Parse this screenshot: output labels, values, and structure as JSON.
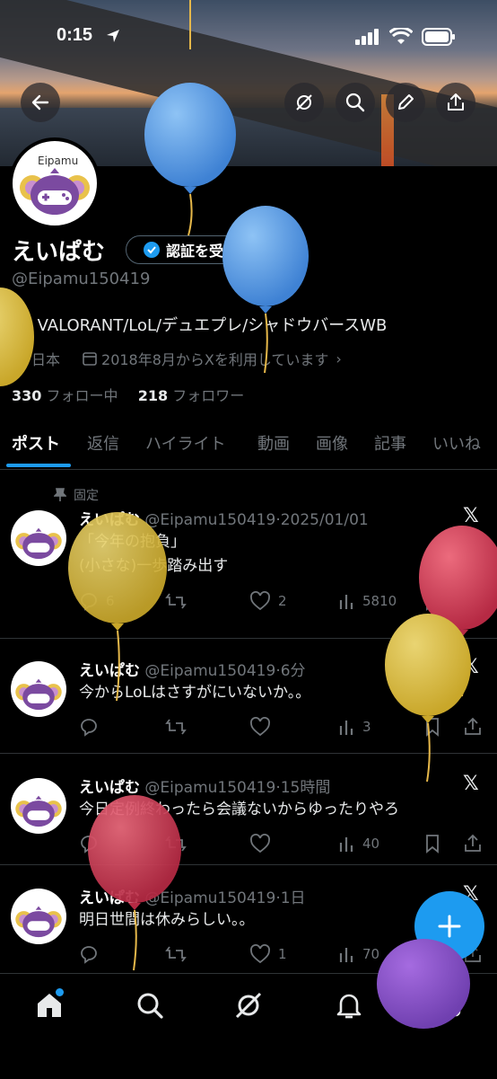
{
  "status_bar": {
    "time": "0:15"
  },
  "profile": {
    "display_name": "えいぱむ",
    "verify_button": "認証を受ける",
    "handle": "@Eipamu150419",
    "bio": "25 VALORANT/LoL/デュエプレ/シャドウバースWB",
    "location": "日本",
    "joined": "2018年8月からXを利用しています",
    "following_count": "330",
    "following_label": "フォロー中",
    "followers_count": "218",
    "followers_label": "フォロワー",
    "avatar_text": "Eipamu"
  },
  "tabs": [
    "ポスト",
    "返信",
    "ハイライト",
    "動画",
    "画像",
    "記事",
    "いいね"
  ],
  "pinned_label": "固定",
  "posts": [
    {
      "name": "えいぱむ",
      "handle": "@Eipamu150419",
      "time": "2025/01/01",
      "line1": "「今年の抱負」",
      "line2": "(小さな)一歩踏み出す",
      "replies": "6",
      "likes": "2",
      "views": "5810"
    },
    {
      "name": "えいぱむ",
      "handle": "@Eipamu150419",
      "time": "6分",
      "line1": "今からLoLはさすがにいないか。。",
      "replies": "",
      "likes": "",
      "views": "3"
    },
    {
      "name": "えいぱむ",
      "handle": "@Eipamu150419",
      "time": "15時間",
      "line1": "今日定例終わったら会議ないからゆったりやろ",
      "replies": "",
      "likes": "",
      "views": "40"
    },
    {
      "name": "えいぱむ",
      "handle": "@Eipamu150419",
      "time": "1日",
      "line1": "明日世間は休みらしい。。",
      "replies": "",
      "likes": "1",
      "views": "70"
    }
  ],
  "colors": {
    "accent": "#1d9bf0",
    "background": "#000000",
    "muted": "#71767b"
  }
}
